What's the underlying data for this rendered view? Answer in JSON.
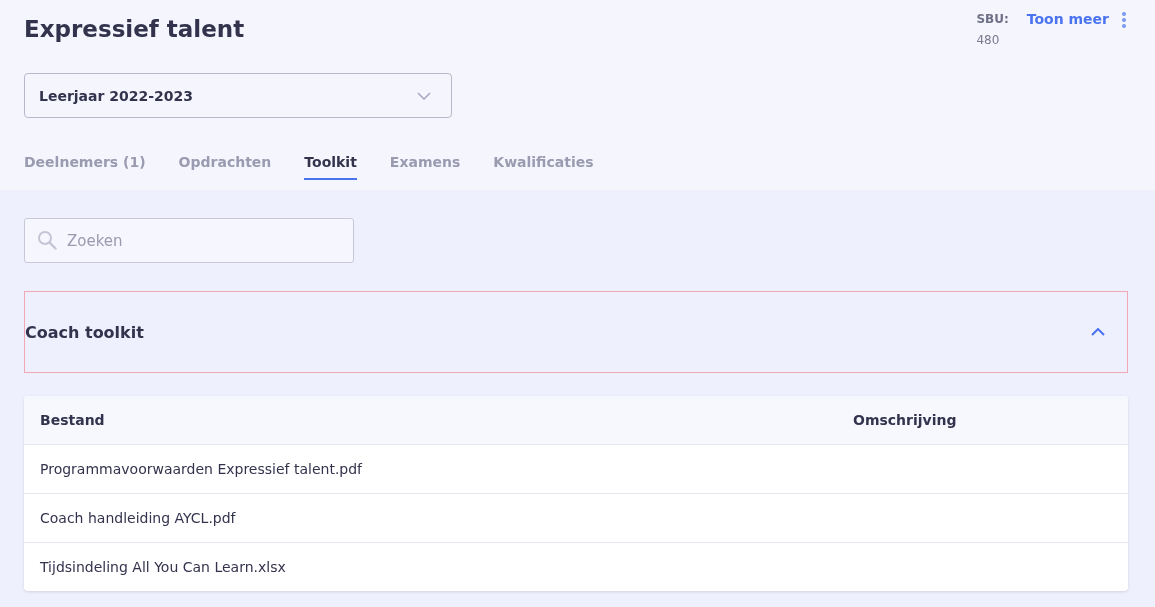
{
  "header": {
    "title": "Expressief talent",
    "sbu_label": "SBU:",
    "sbu_value": "480",
    "more_link": "Toon meer"
  },
  "year_select": {
    "value": "Leerjaar 2022-2023"
  },
  "tabs": [
    {
      "label": "Deelnemers (1)",
      "selected": false
    },
    {
      "label": "Opdrachten",
      "selected": false
    },
    {
      "label": "Toolkit",
      "selected": true
    },
    {
      "label": "Examens",
      "selected": false
    },
    {
      "label": "Kwalificaties",
      "selected": false
    }
  ],
  "search": {
    "placeholder": "Zoeken"
  },
  "section": {
    "title": "Coach toolkit",
    "expanded": true
  },
  "table": {
    "columns": [
      "Bestand",
      "Omschrijving"
    ],
    "rows": [
      [
        "Programmavoorwaarden Expressief talent.pdf",
        ""
      ],
      [
        "Coach handleiding AYCL.pdf",
        ""
      ],
      [
        "Tijdsindeling All You Can Learn.xlsx",
        ""
      ]
    ]
  }
}
